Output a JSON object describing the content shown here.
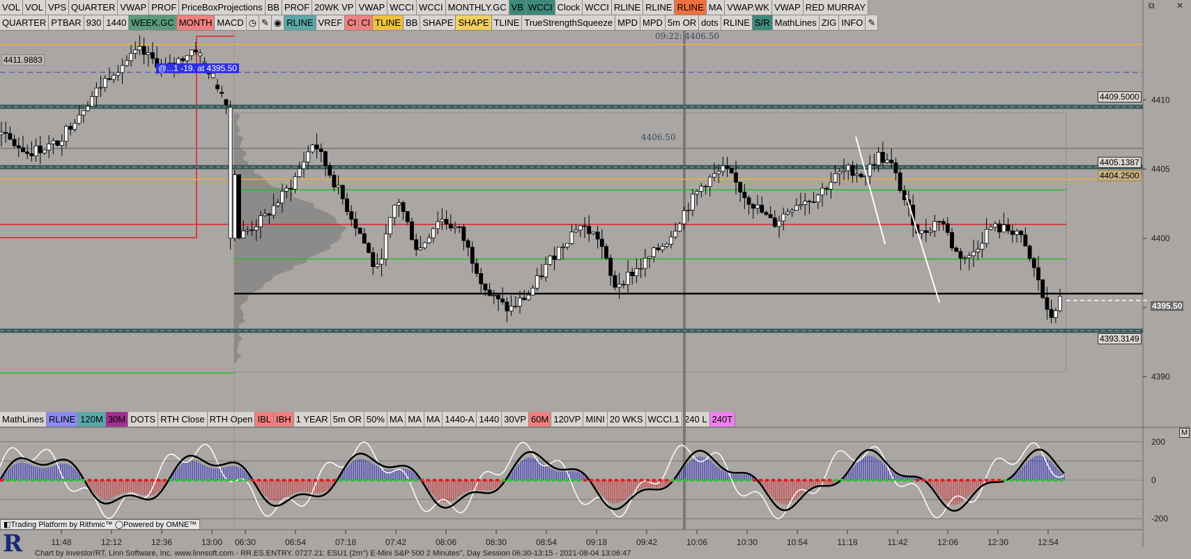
{
  "toolbar_row1": [
    {
      "label": "VOL",
      "bg": "#d8d5d2"
    },
    {
      "label": "VOL",
      "bg": "#d8d5d2"
    },
    {
      "label": "VPS",
      "bg": "#d8d5d2"
    },
    {
      "label": "QUARTER",
      "bg": "#d8d5d2"
    },
    {
      "label": "VWAP",
      "bg": "#d8d5d2"
    },
    {
      "label": "PROF",
      "bg": "#d8d5d2"
    },
    {
      "label": "PriceBoxProjections",
      "bg": "#d8d5d2"
    },
    {
      "label": "BB",
      "bg": "#d8d5d2"
    },
    {
      "label": "PROF",
      "bg": "#d8d5d2"
    },
    {
      "label": "20WK VP",
      "bg": "#d8d5d2"
    },
    {
      "label": "VWAP",
      "bg": "#d8d5d2"
    },
    {
      "label": "WCCI",
      "bg": "#d8d5d2"
    },
    {
      "label": "WCCI",
      "bg": "#d8d5d2"
    },
    {
      "label": "MONTHLY.GC",
      "bg": "#d8d5d2"
    },
    {
      "label": "VB",
      "bg": "#3d8a7a"
    },
    {
      "label": "WCCI",
      "bg": "#3d8a7a"
    },
    {
      "label": "Clock",
      "bg": "#d8d5d2"
    },
    {
      "label": "WCCI",
      "bg": "#d8d5d2"
    },
    {
      "label": "RLINE",
      "bg": "#d8d5d2"
    },
    {
      "label": "RLINE",
      "bg": "#d8d5d2"
    },
    {
      "label": "RLINE",
      "bg": "#f07040"
    },
    {
      "label": "MA",
      "bg": "#d8d5d2"
    },
    {
      "label": "VWAP.WK",
      "bg": "#d8d5d2"
    },
    {
      "label": "VWAP",
      "bg": "#d8d5d2"
    },
    {
      "label": "RED MURRAY",
      "bg": "#d8d5d2"
    }
  ],
  "toolbar_row2": [
    {
      "label": "QUARTER",
      "bg": "#d8d5d2"
    },
    {
      "label": "PTBAR",
      "bg": "#d8d5d2"
    },
    {
      "label": "930",
      "bg": "#d8d5d2"
    },
    {
      "label": "1440",
      "bg": "#d8d5d2"
    },
    {
      "label": "WEEK.GC",
      "bg": "#5a9a7a"
    },
    {
      "label": "MONTH",
      "bg": "#f08080"
    },
    {
      "label": "MACD",
      "bg": "#d8d5d2"
    },
    {
      "label": "◷",
      "bg": "#d8d5d2",
      "icon": "clock-icon"
    },
    {
      "label": "✎",
      "bg": "#d8d5d2",
      "icon": "pencil-icon"
    },
    {
      "label": "◉",
      "bg": "#d8d5d2",
      "icon": "globe-icon"
    },
    {
      "label": "RLINE",
      "bg": "#5aa8a8"
    },
    {
      "label": "VREF",
      "bg": "#d8d5d2"
    },
    {
      "label": "CI",
      "bg": "#f08080"
    },
    {
      "label": "CI",
      "bg": "#f08080"
    },
    {
      "label": "TLINE",
      "bg": "#f0c040"
    },
    {
      "label": "BB",
      "bg": "#d8d5d2"
    },
    {
      "label": "SHAPE",
      "bg": "#d8d5d2"
    },
    {
      "label": "SHAPE",
      "bg": "#f0d060"
    },
    {
      "label": "TLINE",
      "bg": "#d8d5d2"
    },
    {
      "label": "TrueStrengthSqueeze",
      "bg": "#d8d5d2"
    },
    {
      "label": "MPD",
      "bg": "#d8d5d2"
    },
    {
      "label": "MPD",
      "bg": "#d8d5d2"
    },
    {
      "label": "5m OR",
      "bg": "#d8d5d2"
    },
    {
      "label": "dots",
      "bg": "#d8d5d2"
    },
    {
      "label": "RLINE",
      "bg": "#d8d5d2"
    },
    {
      "label": "S/R",
      "bg": "#3d8a7a"
    },
    {
      "label": "MathLines",
      "bg": "#d8d5d2"
    },
    {
      "label": "ZIG",
      "bg": "#d8d5d2"
    },
    {
      "label": "INFO",
      "bg": "#d8d5d2"
    },
    {
      "label": "✎",
      "bg": "#d8d5d2",
      "icon": "pencil-icon"
    }
  ],
  "toolbar_row3": [
    {
      "label": "MathLines",
      "bg": "#d8d5d2"
    },
    {
      "label": "RLINE",
      "bg": "#8c8cf0"
    },
    {
      "label": "120M",
      "bg": "#5aa8a8"
    },
    {
      "label": "30M",
      "bg": "#a03090"
    },
    {
      "label": "DOTS",
      "bg": "#d8d5d2"
    },
    {
      "label": "RTH Close",
      "bg": "#d8d5d2"
    },
    {
      "label": "RTH Open",
      "bg": "#d8d5d2"
    },
    {
      "label": "IBL",
      "bg": "#f08080"
    },
    {
      "label": "IBH",
      "bg": "#f08080"
    },
    {
      "label": "1 YEAR",
      "bg": "#d8d5d2"
    },
    {
      "label": "5m OR",
      "bg": "#d8d5d2"
    },
    {
      "label": "50%",
      "bg": "#d8d5d2"
    },
    {
      "label": "MA",
      "bg": "#d8d5d2"
    },
    {
      "label": "MA",
      "bg": "#d8d5d2"
    },
    {
      "label": "MA",
      "bg": "#d8d5d2"
    },
    {
      "label": "1440-A",
      "bg": "#d8d5d2"
    },
    {
      "label": "1440",
      "bg": "#d8d5d2"
    },
    {
      "label": "30VP",
      "bg": "#d8d5d2"
    },
    {
      "label": "60M",
      "bg": "#f08080"
    },
    {
      "label": "120VP",
      "bg": "#d8d5d2"
    },
    {
      "label": "MINI",
      "bg": "#d8d5d2"
    },
    {
      "label": "20 WKS",
      "bg": "#d8d5d2"
    },
    {
      "label": "WCCI.1",
      "bg": "#d8d5d2"
    },
    {
      "label": "240 L",
      "bg": "#d8d5d2"
    },
    {
      "label": "240T",
      "bg": "#f080f0"
    }
  ],
  "window_controls": {
    "restore": "⧉",
    "close": "✕"
  },
  "price_labels": [
    {
      "text": "4411.9883"
    },
    {
      "text": "4409.5000"
    },
    {
      "text": "4405.1387"
    },
    {
      "text": "4404.2500"
    },
    {
      "text": "4395.50"
    },
    {
      "text": "4393.3149"
    }
  ],
  "annotations": {
    "clock_label": "09:22: 4406.50",
    "level_label": "4406.50",
    "order_label": "@...1   -19.  at 4395.50"
  },
  "indicator_badge": "M",
  "rithmic_text": "◧Trading Platform by Rithmic™  ◯Powered by OMNE™",
  "footer": "Chart by Investor/RT, Linn Software, Inc. www.linnsoft.com - RR.ES.ENTRY.   0727.21: ESU1 (2m°) E-Mini S&P 500 2 Minutes°, Day Session 06:30-13:15 - 2021-08-04 13:06:47",
  "logo_letter": "R",
  "chart_data": {
    "type": "candlestick",
    "title": "",
    "instrument": "ESU1 E-Mini S&P 500 2 Minutes",
    "y_ticks": [
      4410,
      4405,
      4400,
      4395,
      4390
    ],
    "y_range": [
      4387.5,
      4415
    ],
    "x_ticks": [
      "11:48",
      "12:12",
      "12:36",
      "13:00",
      "06:30",
      "06:54",
      "07:18",
      "07:42",
      "08:06",
      "08:30",
      "08:54",
      "09:18",
      "09:42",
      "10:06",
      "10:30",
      "10:54",
      "11:18",
      "11:42",
      "12:06",
      "12:30",
      "12:54"
    ],
    "levels": [
      {
        "price": 4414.0,
        "color": "#f0b030"
      },
      {
        "price": 4411.9883,
        "color": "#4040c0",
        "style": "dashed"
      },
      {
        "price": 4409.5,
        "color": "#3a5a58",
        "style": "band"
      },
      {
        "price": 4406.5,
        "color": "#7a7775"
      },
      {
        "price": 4405.1387,
        "color": "#3a5a58",
        "style": "band"
      },
      {
        "price": 4404.25,
        "color": "#f0b030"
      },
      {
        "price": 4403.5,
        "color": "#20c020"
      },
      {
        "price": 4401.0,
        "color": "#e02020"
      },
      {
        "price": 4398.5,
        "color": "#20c020"
      },
      {
        "price": 4396.0,
        "color": "#000000"
      },
      {
        "price": 4393.3149,
        "color": "#3a5a58",
        "style": "band"
      }
    ],
    "current_price": 4395.5,
    "indicator": {
      "y_ticks": [
        200,
        0,
        -200
      ],
      "y_range": [
        -250,
        250
      ]
    }
  }
}
